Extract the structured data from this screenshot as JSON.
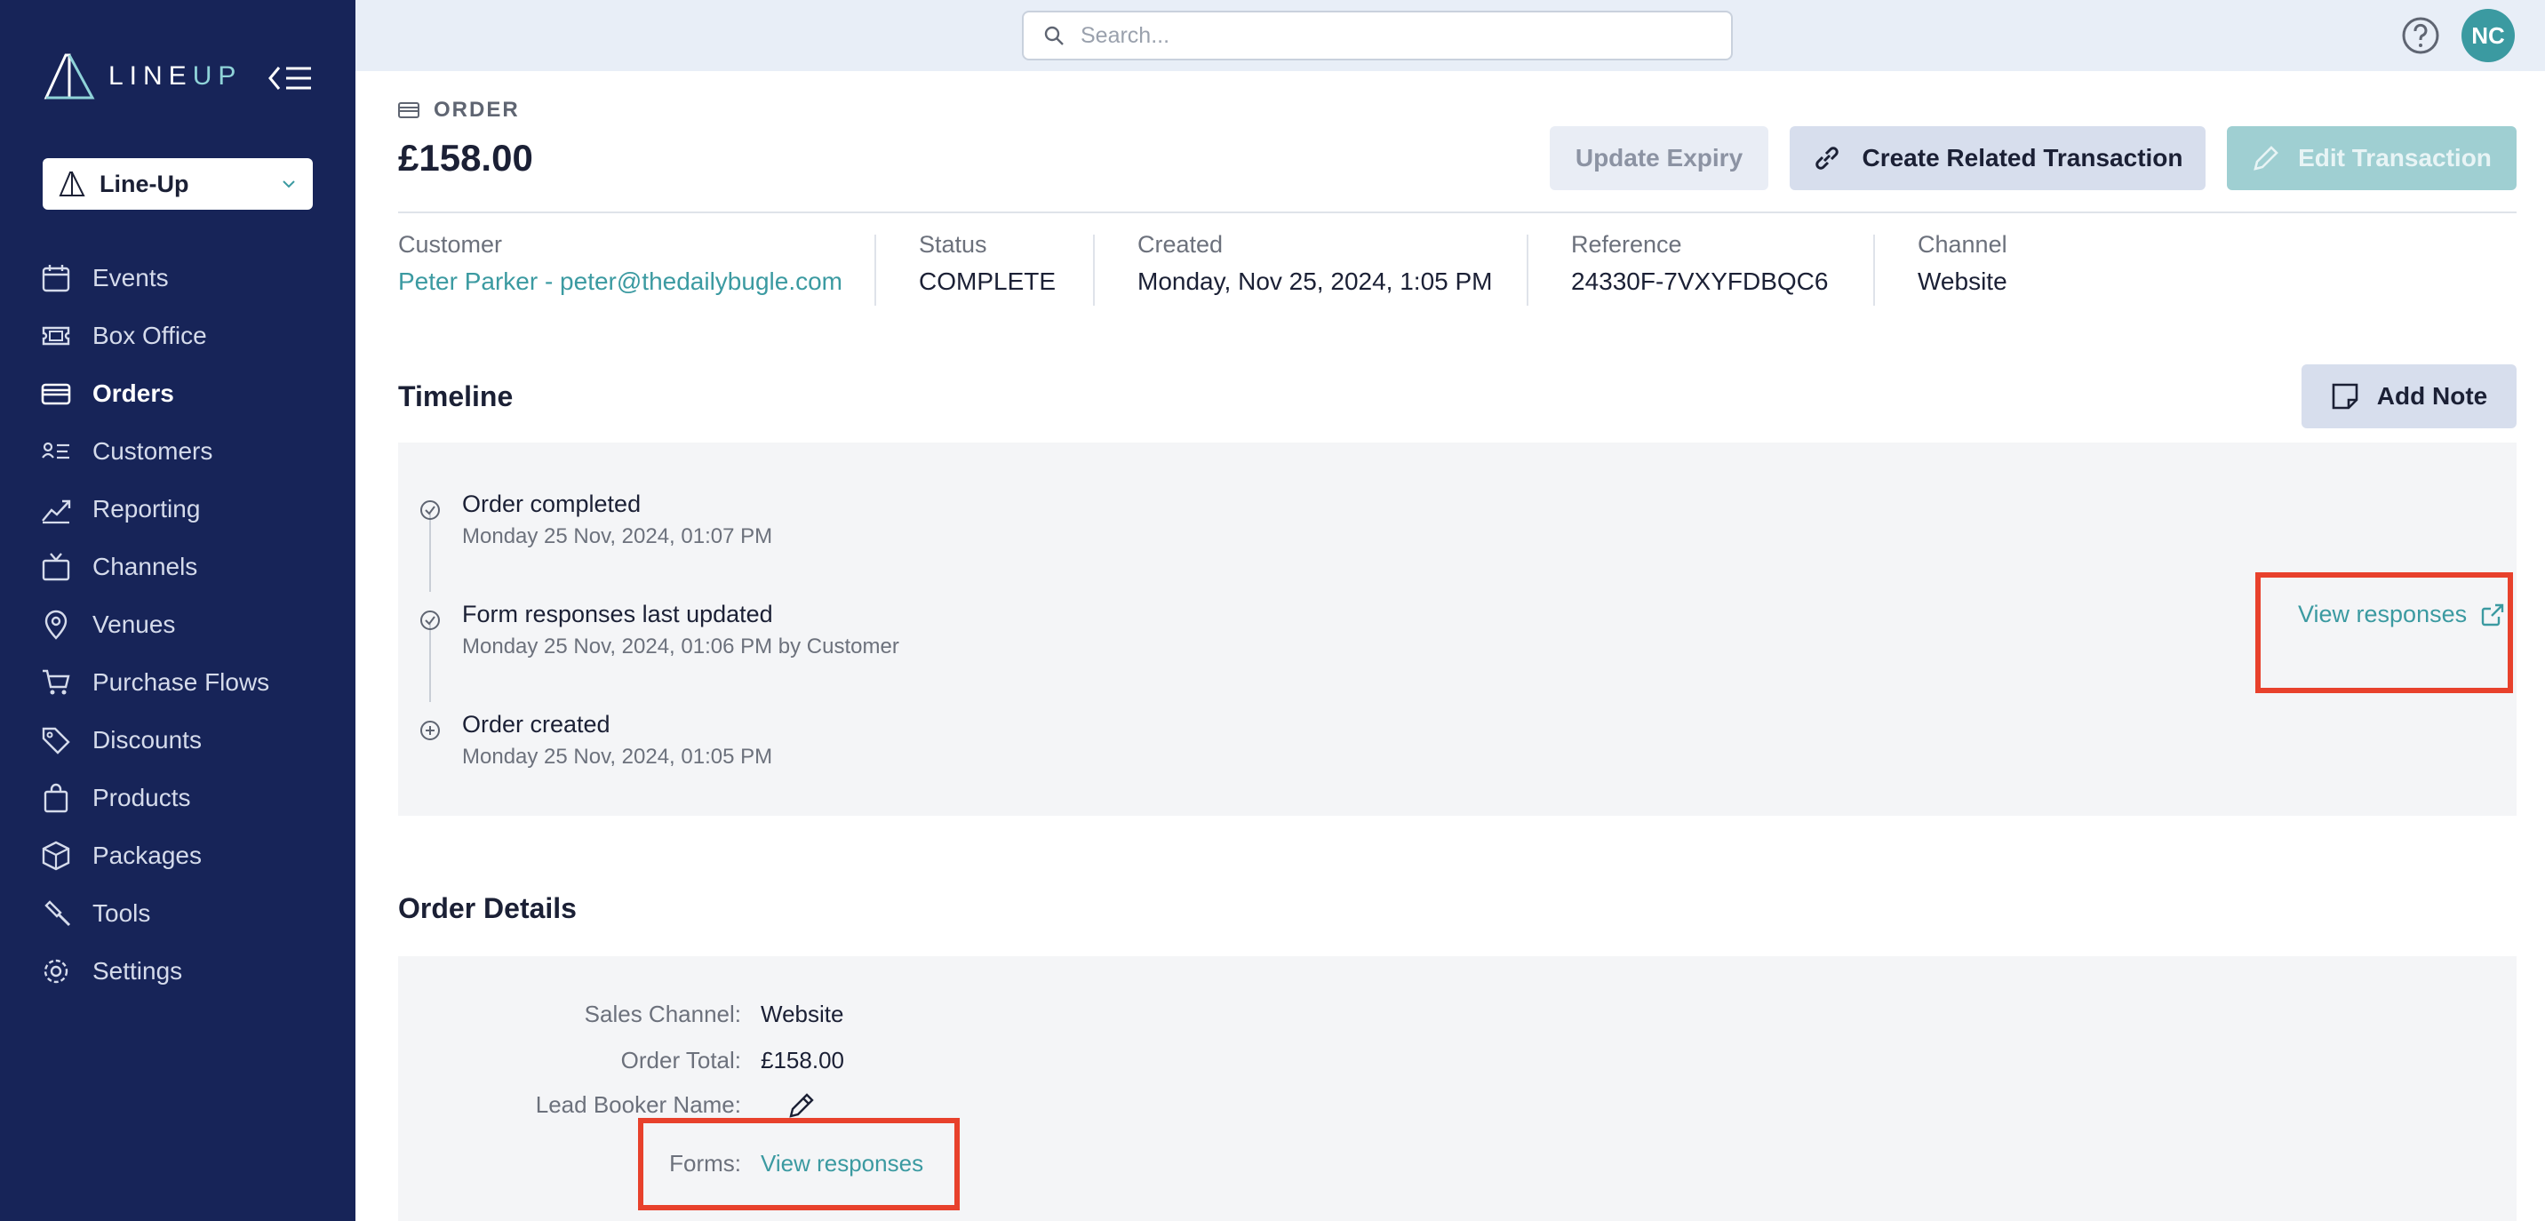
{
  "sidebar": {
    "logo_text": "LINE",
    "logo_accent": "UP",
    "org_select": "Line-Up",
    "items": [
      {
        "label": "Events",
        "icon": "calendar-icon",
        "active": false
      },
      {
        "label": "Box Office",
        "icon": "ticket-icon",
        "active": false
      },
      {
        "label": "Orders",
        "icon": "credit-card-icon",
        "active": true
      },
      {
        "label": "Customers",
        "icon": "contacts-icon",
        "active": false
      },
      {
        "label": "Reporting",
        "icon": "chart-line-icon",
        "active": false
      },
      {
        "label": "Channels",
        "icon": "tv-icon",
        "active": false
      },
      {
        "label": "Venues",
        "icon": "map-pin-icon",
        "active": false
      },
      {
        "label": "Purchase Flows",
        "icon": "cart-icon",
        "active": false
      },
      {
        "label": "Discounts",
        "icon": "tags-icon",
        "active": false
      },
      {
        "label": "Products",
        "icon": "shopping-bag-icon",
        "active": false
      },
      {
        "label": "Packages",
        "icon": "package-icon",
        "active": false
      },
      {
        "label": "Tools",
        "icon": "hammer-icon",
        "active": false
      },
      {
        "label": "Settings",
        "icon": "gear-icon",
        "active": false
      }
    ]
  },
  "header": {
    "search_placeholder": "Search...",
    "avatar_initials": "NC"
  },
  "order": {
    "label": "ORDER",
    "price": "£158.00",
    "buttons": {
      "update_expiry": "Update Expiry",
      "create_related": "Create Related Transaction",
      "edit_transaction": "Edit Transaction"
    },
    "meta": {
      "customer_label": "Customer",
      "customer_value": "Peter Parker - peter@thedailybugle.com",
      "status_label": "Status",
      "status_value": "COMPLETE",
      "created_label": "Created",
      "created_value": "Monday, Nov 25, 2024, 1:05 PM",
      "reference_label": "Reference",
      "reference_value": "24330F-7VXYFDBQC6",
      "channel_label": "Channel",
      "channel_value": "Website"
    }
  },
  "timeline": {
    "title": "Timeline",
    "add_note": "Add Note",
    "events": [
      {
        "title": "Order completed",
        "date": "Monday 25 Nov, 2024, 01:07 PM",
        "icon": "check-circle-icon"
      },
      {
        "title": "Form responses last updated",
        "date": "Monday 25 Nov, 2024, 01:06 PM by Customer",
        "icon": "check-circle-icon"
      },
      {
        "title": "Order created",
        "date": "Monday 25 Nov, 2024, 01:05 PM",
        "icon": "plus-circle-icon"
      }
    ],
    "view_responses": "View responses"
  },
  "details": {
    "title": "Order Details",
    "rows": [
      {
        "label": "Sales Channel:",
        "value": "Website"
      },
      {
        "label": "Order Total:",
        "value": "£158.00"
      },
      {
        "label": "Lead Booker Name:",
        "value": ""
      },
      {
        "label": "Forms:",
        "value": "View responses"
      }
    ]
  },
  "colors": {
    "sidebar_bg": "#172458",
    "accent": "#3b9aa1",
    "highlight": "#e8412c"
  }
}
